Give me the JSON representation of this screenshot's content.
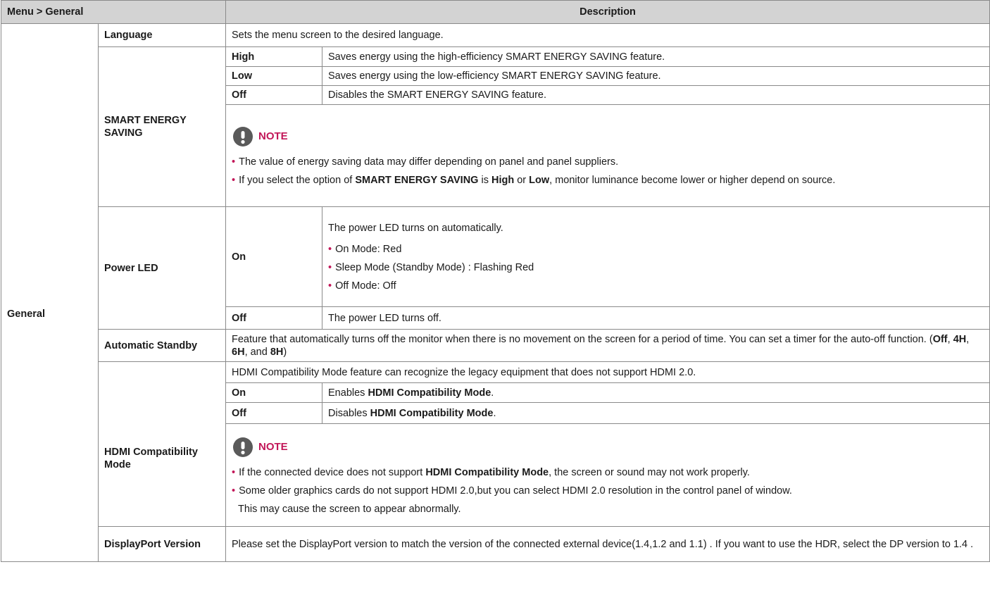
{
  "header": {
    "menu": "Menu > General",
    "description": "Description"
  },
  "section": "General",
  "language": {
    "label": "Language",
    "desc": "Sets the menu screen to the desired language."
  },
  "energy": {
    "label": "SMART ENERGY SAVING",
    "options": [
      {
        "name": "High",
        "desc": "Saves energy using the high-efficiency SMART ENERGY SAVING feature."
      },
      {
        "name": "Low",
        "desc": "Saves energy using the low-efficiency SMART ENERGY SAVING feature."
      },
      {
        "name": "Off",
        "desc": "Disables the SMART ENERGY SAVING feature."
      }
    ],
    "note_label": "NOTE",
    "note1": "The value of energy saving data may differ depending on panel and panel suppliers.",
    "note2": {
      "a": "If you select the option of ",
      "b": "SMART ENERGY SAVING",
      "c": " is ",
      "d": "High",
      "e": " or ",
      "f": "Low",
      "g": ", monitor luminance become lower or higher depend on source."
    }
  },
  "power_led": {
    "label": "Power LED",
    "on": "On",
    "on_desc": "The power LED turns on automatically.",
    "on_items": [
      "On Mode: Red",
      "Sleep Mode (Standby Mode) : Flashing Red",
      "Off Mode: Off"
    ],
    "off": "Off",
    "off_desc": "The power LED turns off."
  },
  "standby": {
    "label": "Automatic Standby",
    "desc_a": "Feature that automatically turns off the monitor when there is no movement on the screen for a period of time. You can set a timer for the auto-off function. (",
    "v1": "Off",
    "sep1": ", ",
    "v2": "4H",
    "sep2": ", ",
    "v3": "6H",
    "sep3": ", and ",
    "v4": "8H",
    "end": ")"
  },
  "hdmi": {
    "label": "HDMI Compatibility Mode",
    "intro": "HDMI Compatibility Mode feature can recognize the legacy equipment that does not support HDMI 2.0.",
    "on": "On",
    "on_pre": "Enables ",
    "on_bold": "HDMI Compatibility Mode",
    "on_post": ".",
    "off": "Off",
    "off_pre": "Disables ",
    "off_bold": "HDMI Compatibility Mode",
    "off_post": ".",
    "note_label": "NOTE",
    "note1_a": "If the connected device does not support ",
    "note1_b": "HDMI Compatibility Mode",
    "note1_c": ", the screen or sound may not work properly.",
    "note2": "Some older graphics cards do not support HDMI 2.0,but you can select HDMI 2.0 resolution in the control panel of window.",
    "note3": "This may cause the screen to appear abnormally."
  },
  "dp": {
    "label": "DisplayPort Version",
    "desc": "Please set the DisplayPort version to match the version of the connected external device(1.4,1.2 and 1.1) . If you want to use the HDR, select the DP version to 1.4 ."
  },
  "colors": {
    "header_bg": "#d3d3d3",
    "accent": "#c21658",
    "border": "#8a8a8a",
    "icon_bg": "#5a5a5a"
  }
}
